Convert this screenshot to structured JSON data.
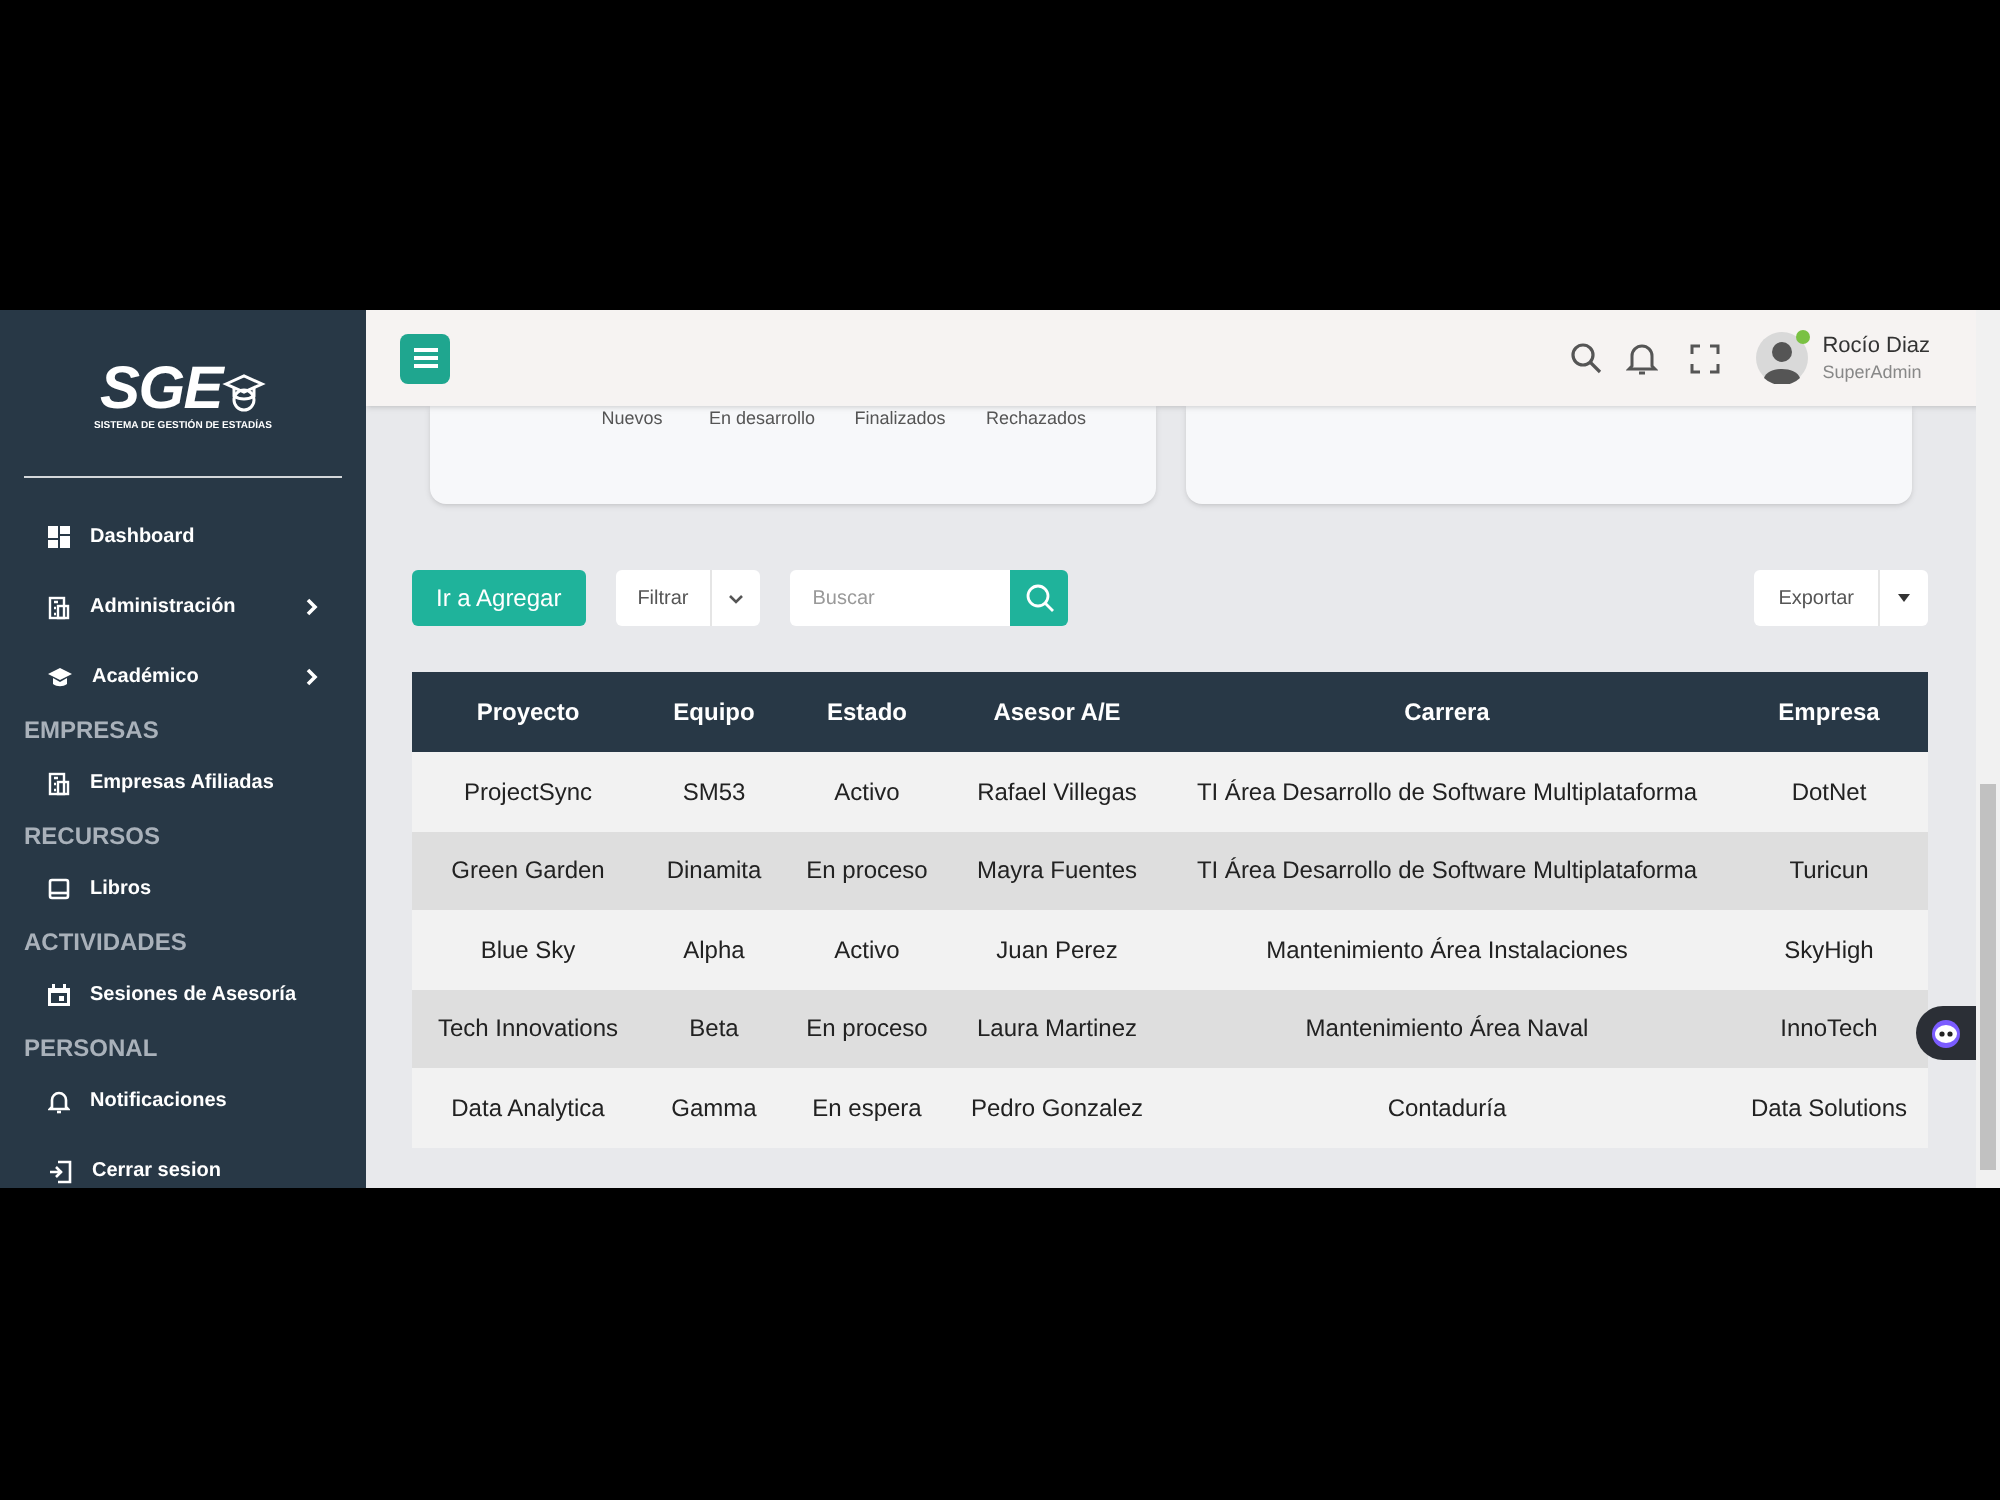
{
  "logo": {
    "title": "SGE",
    "subtitle": "SISTEMA DE GESTIÓN DE ESTADÍAS"
  },
  "sidebar": {
    "items": [
      {
        "kind": "item",
        "label": "Dashboard",
        "has_submenu": false
      },
      {
        "kind": "item",
        "label": "Administración",
        "has_submenu": true
      },
      {
        "kind": "item",
        "label": "Académico",
        "has_submenu": true
      },
      {
        "kind": "section",
        "label": "EMPRESAS"
      },
      {
        "kind": "item",
        "label": "Empresas Afiliadas",
        "has_submenu": false
      },
      {
        "kind": "section",
        "label": "RECURSOS"
      },
      {
        "kind": "item",
        "label": "Libros",
        "has_submenu": false
      },
      {
        "kind": "section",
        "label": "ACTIVIDADES"
      },
      {
        "kind": "item",
        "label": "Sesiones de Asesoría",
        "has_submenu": false
      },
      {
        "kind": "section",
        "label": "PERSONAL"
      },
      {
        "kind": "item",
        "label": "Notificaciones",
        "has_submenu": false
      },
      {
        "kind": "logout",
        "label": "Cerrar sesion",
        "has_submenu": false
      }
    ]
  },
  "header": {
    "user": {
      "name": "Rocío Diaz",
      "role": "SuperAdmin",
      "online": true
    }
  },
  "stats_card": {
    "labels": [
      "Nuevos",
      "En desarrollo",
      "Finalizados",
      "Rechazados"
    ]
  },
  "toolbar": {
    "add_button": "Ir a Agregar",
    "filter": "Filtrar",
    "search": {
      "placeholder": "Buscar"
    },
    "export": "Exportar"
  },
  "table": {
    "columns": [
      "Proyecto",
      "Equipo",
      "Estado",
      "Asesor A/E",
      "Carrera",
      "Empresa"
    ],
    "rows": [
      [
        "ProjectSync",
        "SM53",
        "Activo",
        "Rafael Villegas",
        "TI Área Desarrollo de Software Multiplataforma",
        "DotNet"
      ],
      [
        "Green Garden",
        "Dinamita",
        "En proceso",
        "Mayra Fuentes",
        "TI Área Desarrollo de Software Multiplataforma",
        "Turicun"
      ],
      [
        "Blue Sky",
        "Alpha",
        "Activo",
        "Juan Perez",
        "Mantenimiento Área Instalaciones",
        "SkyHigh"
      ],
      [
        "Tech Innovations",
        "Beta",
        "En proceso",
        "Laura Martinez",
        "Mantenimiento Área Naval",
        "InnoTech"
      ],
      [
        "Data Analytica",
        "Gamma",
        "En espera",
        "Pedro Gonzalez",
        "Contaduría",
        "Data Solutions"
      ]
    ]
  }
}
